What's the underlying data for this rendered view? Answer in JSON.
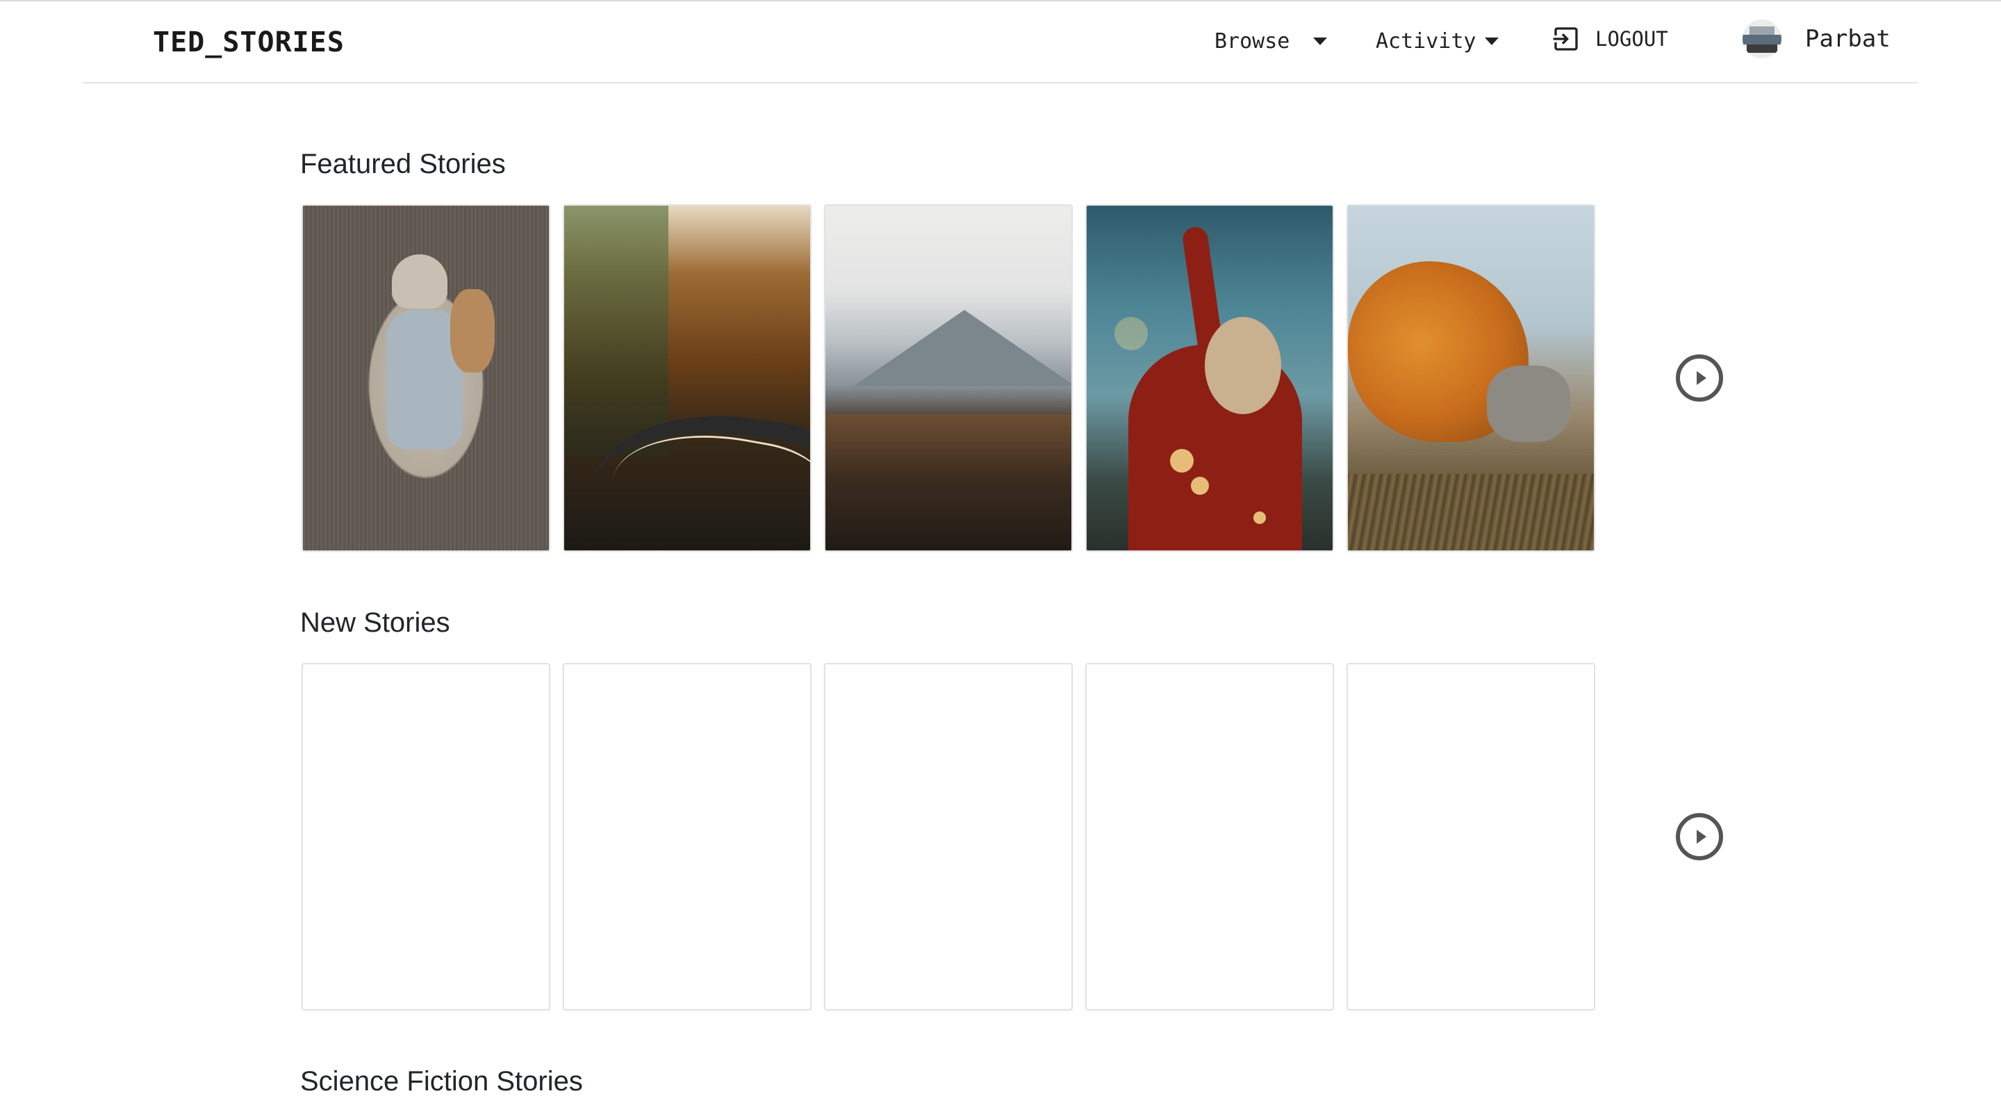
{
  "navbar": {
    "brand": "TED_STORIES",
    "browse_label": "Browse",
    "activity_label": "Activity",
    "logout_label": "LOGOUT",
    "username": "Parbat",
    "icons": {
      "browse": "chevron-down-icon",
      "activity": "chevron-down-icon",
      "logout": "logout-icon",
      "avatar": "user-avatar"
    }
  },
  "sections": [
    {
      "title": "Featured Stories",
      "cards": [
        {
          "image": "baby clothes and stuffed lion in basket"
        },
        {
          "image": "winding road through autumn forest"
        },
        {
          "image": "misty mountain range over dark hills"
        },
        {
          "image": "woman in red sweater with raised arms and bokeh lights"
        },
        {
          "image": "red fox with nose in grass"
        }
      ],
      "next_icon": "chevron-right-circle-icon"
    },
    {
      "title": "New Stories",
      "cards": [
        {},
        {},
        {},
        {},
        {}
      ],
      "next_icon": "chevron-right-circle-icon"
    },
    {
      "title": "Science Fiction Stories"
    }
  ],
  "colors": {
    "text": "#212529",
    "border": "#e2e2e2",
    "icon": "#555555"
  }
}
